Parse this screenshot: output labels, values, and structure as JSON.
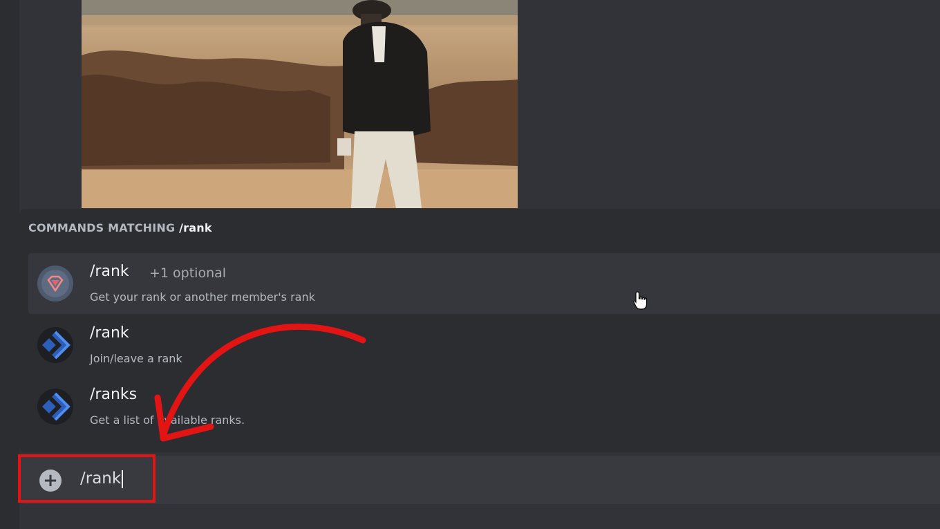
{
  "popout": {
    "header_prefix": "COMMANDS MATCHING",
    "header_query": "/rank"
  },
  "commands": [
    {
      "name": "/rank",
      "options": "+1 optional",
      "description": "Get your rank or another member's rank",
      "icon": "gem-shield-icon",
      "selected": true
    },
    {
      "name": "/rank",
      "options": "",
      "description": "Join/leave a rank",
      "icon": "bot-chevron-icon",
      "selected": false
    },
    {
      "name": "/ranks",
      "options": "",
      "description": "Get a list of available ranks.",
      "icon": "bot-chevron-icon",
      "selected": false
    }
  ],
  "input": {
    "value": "/rank",
    "add_icon": "plus-circle-icon"
  },
  "colors": {
    "background": "#313338",
    "popout": "#2b2d31",
    "selected_row": "#35373c",
    "input_bar": "#383a40",
    "annotation_red": "#e21414",
    "bot_icon_blue": "#3a6fd8"
  }
}
